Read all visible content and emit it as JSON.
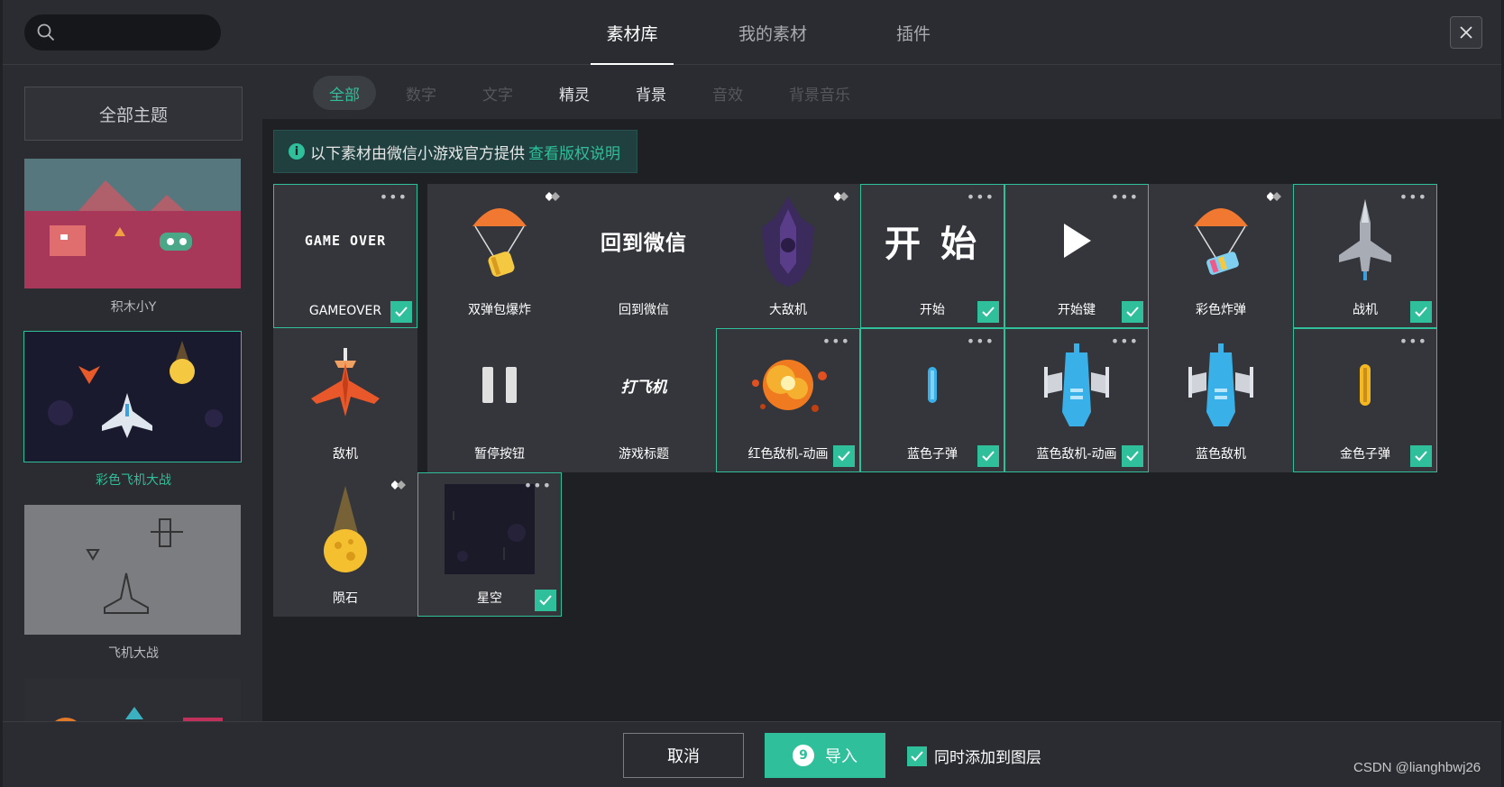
{
  "search": {
    "placeholder": ""
  },
  "tabs": [
    {
      "label": "素材库",
      "active": true
    },
    {
      "label": "我的素材",
      "active": false
    },
    {
      "label": "插件",
      "active": false
    }
  ],
  "sidebar": {
    "all_themes": "全部主题",
    "themes": [
      {
        "label": "积木小Y",
        "active": false
      },
      {
        "label": "彩色飞机大战",
        "active": true
      },
      {
        "label": "飞机大战",
        "active": false
      }
    ]
  },
  "filters": [
    {
      "label": "全部",
      "state": "active"
    },
    {
      "label": "数字",
      "state": "disabled"
    },
    {
      "label": "文字",
      "state": "disabled"
    },
    {
      "label": "精灵",
      "state": "enabled"
    },
    {
      "label": "背景",
      "state": "enabled"
    },
    {
      "label": "音效",
      "state": "disabled"
    },
    {
      "label": "背景音乐",
      "state": "disabled"
    }
  ],
  "notice": {
    "text": "以下素材由微信小游戏官方提供",
    "link": "查看版权说明"
  },
  "assets": [
    {
      "name": "GAMEOVER",
      "selected": true,
      "icon": "gameover-text",
      "label_text": "GAME OVER"
    },
    {
      "name": "双弹包爆炸",
      "selected": false,
      "icon": "parachute-bullets"
    },
    {
      "name": "回到微信",
      "selected": false,
      "icon": "back-to-wechat-text",
      "label_text": "回到微信"
    },
    {
      "name": "大敌机",
      "selected": false,
      "icon": "big-enemy-plane"
    },
    {
      "name": "开始",
      "selected": true,
      "icon": "start-text",
      "label_text": "开 始"
    },
    {
      "name": "开始键",
      "selected": true,
      "icon": "play-icon"
    },
    {
      "name": "彩色炸弹",
      "selected": false,
      "icon": "parachute-bomb"
    },
    {
      "name": "战机",
      "selected": true,
      "icon": "fighter-plane"
    },
    {
      "name": "敌机",
      "selected": false,
      "icon": "enemy-plane"
    },
    {
      "name": "暂停按钮",
      "selected": false,
      "icon": "pause-icon"
    },
    {
      "name": "游戏标题",
      "selected": false,
      "icon": "game-title",
      "label_text": "打飞机"
    },
    {
      "name": "红色敌机-动画",
      "selected": true,
      "icon": "explosion"
    },
    {
      "name": "蓝色子弹",
      "selected": true,
      "icon": "blue-bullet"
    },
    {
      "name": "蓝色敌机-动画",
      "selected": true,
      "icon": "blue-enemy-plane"
    },
    {
      "name": "蓝色敌机",
      "selected": false,
      "icon": "blue-enemy-plane"
    },
    {
      "name": "金色子弹",
      "selected": true,
      "icon": "gold-bullet"
    },
    {
      "name": "陨石",
      "selected": false,
      "icon": "meteor"
    },
    {
      "name": "星空",
      "selected": true,
      "icon": "starry-sky"
    }
  ],
  "footer": {
    "cancel": "取消",
    "import_count": "9",
    "import": "导入",
    "add_to_layer": "同时添加到图层",
    "add_to_layer_checked": true
  },
  "watermark": "CSDN @lianghbwj26",
  "colors": {
    "accent": "#2fbf9a",
    "panel": "#2a2c31",
    "card": "#34363b",
    "content_bg": "#1e2024"
  }
}
